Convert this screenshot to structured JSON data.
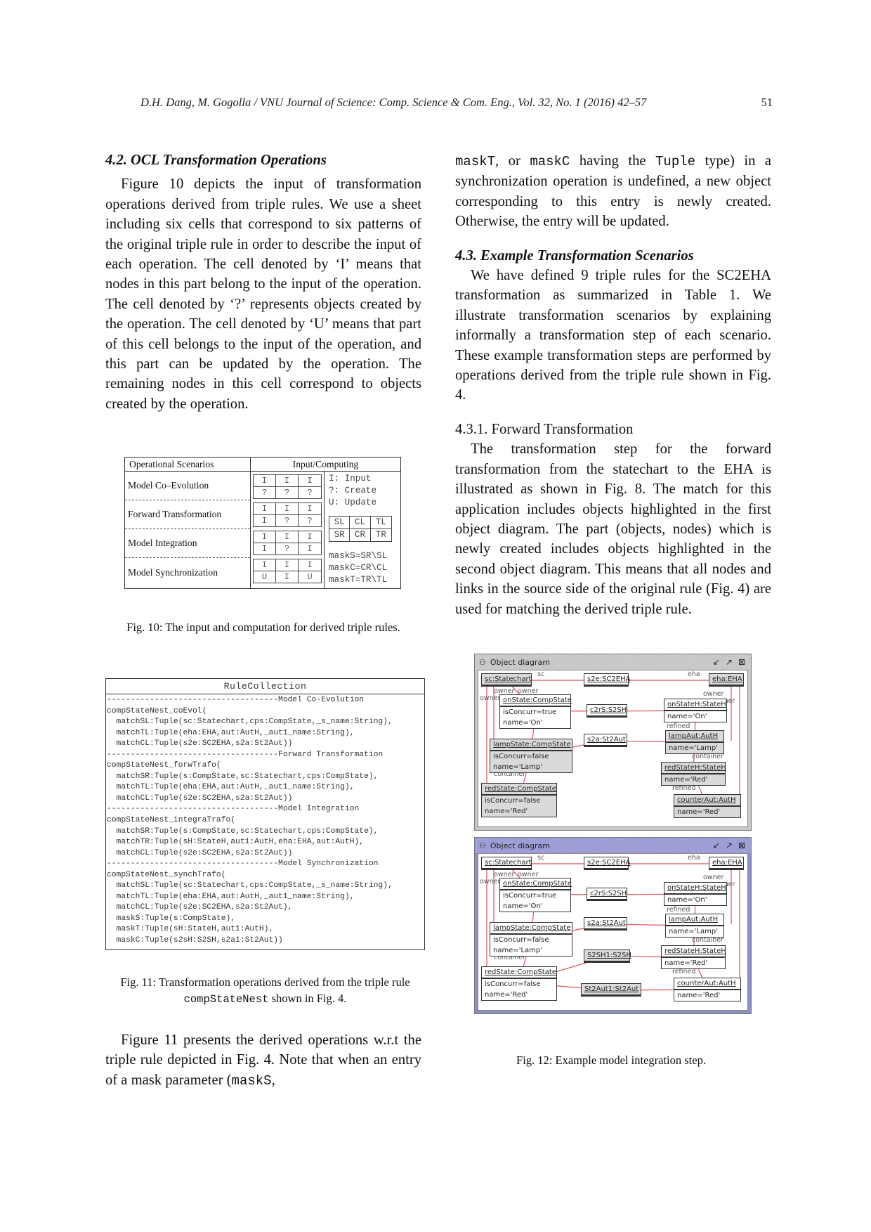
{
  "header": {
    "running_head": "D.H. Dang, M. Gogolla / VNU Journal of Science: Comp. Science & Com. Eng., Vol. 32, No. 1 (2016) 42–57",
    "page_number": "51"
  },
  "left_column": {
    "section_heading": "4.2.  OCL Transformation Operations",
    "paragraph_1": "Figure 10 depicts the input of transformation operations derived from triple rules.  We use a sheet including six cells that correspond to six patterns of the original triple rule in order to describe the input of each operation.  The cell denoted by ‘I’ means that nodes in this part belong to the input of the operation.  The cell denoted by ‘?’  represents objects created by the operation.  The cell denoted by ‘U’ means that part of this cell belongs to the input of the operation, and this part can be updated by the operation.  The remaining nodes in this cell correspond to objects created by the operation.",
    "paragraph_2_pre": "Figure 11 presents the derived operations w.r.t the triple rule depicted in Fig. 4.  Note that when an entry of a mask parameter (",
    "paragraph_2_code": "maskS",
    "paragraph_2_post": ","
  },
  "fig10": {
    "header_scenarios": "Operational Scenarios",
    "header_computing": "Input/Computing",
    "rows": [
      {
        "scenario": "Model Co–Evolution",
        "cells": [
          "I",
          "I",
          "I",
          "?",
          "?",
          "?"
        ]
      },
      {
        "scenario": "Forward Transformation",
        "cells": [
          "I",
          "I",
          "I",
          "I",
          "?",
          "?"
        ]
      },
      {
        "scenario": "Model Integration",
        "cells": [
          "I",
          "I",
          "I",
          "I",
          "?",
          "I"
        ]
      },
      {
        "scenario": "Model Synchronization",
        "cells": [
          "I",
          "I",
          "I",
          "U",
          "I",
          "U"
        ]
      }
    ],
    "legend": [
      "I: Input",
      "?: Create",
      "U: Update"
    ],
    "pattern_grid": [
      "SL",
      "CL",
      "TL",
      "SR",
      "CR",
      "TR"
    ],
    "masks": [
      "maskS=SR\\SL",
      "maskC=CR\\CL",
      "maskT=TR\\TL"
    ],
    "caption": "Fig. 10: The input and computation for derived triple rules."
  },
  "fig11": {
    "title": "RuleCollection",
    "lines": [
      "------------------------------------Model Co-Evolution",
      "compStateNest_coEvol(",
      "  matchSL:Tuple(sc:Statechart,cps:CompState,_s_name:String),",
      "  matchTL:Tuple(eha:EHA,aut:AutH,_aut1_name:String),",
      "  matchCL:Tuple(s2e:SC2EHA,s2a:St2Aut))",
      "------------------------------------Forward Transformation",
      "compStateNest_forwTrafo(",
      "  matchSR:Tuple(s:CompState,sc:Statechart,cps:CompState),",
      "  matchTL:Tuple(eha:EHA,aut:AutH,_aut1_name:String),",
      "  matchCL:Tuple(s2e:SC2EHA,s2a:St2Aut))",
      "------------------------------------Model Integration",
      "compStateNest_integraTrafo(",
      "  matchSR:Tuple(s:CompState,sc:Statechart,cps:CompState),",
      "  matchTR:Tuple(sH:StateH,aut1:AutH,eha:EHA,aut:AutH),",
      "  matchCL:Tuple(s2e:SC2EHA,s2a:St2Aut))",
      "------------------------------------Model Synchronization",
      "compStateNest_synchTrafo(",
      "  matchSL:Tuple(sc:Statechart,cps:CompState,_s_name:String),",
      "  matchTL:Tuple(eha:EHA,aut:AutH,_aut1_name:String),",
      "  matchCL:Tuple(s2e:SC2EHA,s2a:St2Aut),",
      "  maskS:Tuple(s:CompState),",
      "  maskT:Tuple(sH:StateH,aut1:AutH),",
      "  maskC:Tuple(s2sH:S2SH,s2a1:St2Aut))"
    ],
    "caption_pre": "Fig. 11: Transformation operations derived from the triple rule ",
    "caption_code": "compStateNest",
    "caption_post": " shown in Fig. 4."
  },
  "right_column": {
    "para_cont_code1": "maskT",
    "para_cont_mid1": ", or ",
    "para_cont_code2": "maskC",
    "para_cont_mid2": " having the ",
    "para_cont_code3": "Tuple",
    "para_cont_post": " type) in a synchronization operation is undefined, a new object corresponding to this entry is newly created. Otherwise, the entry will be updated.",
    "section_heading": "4.3.  Example Transformation Scenarios",
    "paragraph_1": "We have defined 9 triple rules for the SC2EHA transformation as summarized in Table 1.  We illustrate transformation scenarios by explaining informally a transformation step of each scenario.  These example transformation steps are performed by operations derived from the triple rule shown in Fig. 4.",
    "subsection_heading": "4.3.1.  Forward Transformation",
    "paragraph_2": "The transformation step for the forward transformation from the statechart to the EHA is illustrated as shown in Fig. 8.  The match for this application includes objects highlighted in the first object diagram.  The part (objects, nodes) which is newly created includes objects highlighted in the second object diagram.  This means that all nodes and links in the source side of the original rule (Fig. 4) are used for matching the derived triple rule."
  },
  "fig12": {
    "caption": "Fig. 12: Example model integration step.",
    "windows": [
      {
        "title": "Object diagram",
        "objects": {
          "sc": {
            "name": "sc:Statechart",
            "attrs": []
          },
          "s2e": {
            "name": "s2e:SC2EHA",
            "attrs": []
          },
          "eha": {
            "name": "eha:EHA",
            "attrs": []
          },
          "onState": {
            "name": "onState:CompState",
            "attrs": [
              "isConcurr=true",
              "name='On'"
            ]
          },
          "c2rS": {
            "name": "c2rS:S2SH",
            "attrs": []
          },
          "onStateH": {
            "name": "onStateH:StateH",
            "attrs": [
              "name='On'"
            ]
          },
          "lampState": {
            "name": "lampState:CompState",
            "attrs": [
              "isConcurr=false",
              "name='Lamp'"
            ]
          },
          "s2a": {
            "name": "s2a:St2Aut",
            "attrs": []
          },
          "lampAut": {
            "name": "lampAut:AutH",
            "attrs": [
              "name='Lamp'"
            ]
          },
          "redStateH": {
            "name": "redStateH:StateH",
            "attrs": [
              "name='Red'"
            ]
          },
          "redState": {
            "name": "redState:CompState",
            "attrs": [
              "isConcurr=false",
              "name='Red'"
            ]
          },
          "counterAut": {
            "name": "counterAut:AutH",
            "attrs": [
              "name='Red'"
            ]
          }
        },
        "role_labels": [
          "sc",
          "eha",
          "owner",
          "owner",
          "owner",
          "owner",
          "owner",
          "container",
          "refined",
          "container",
          "container",
          "refined"
        ]
      },
      {
        "title": "Object diagram",
        "objects": {
          "sc": {
            "name": "sc:Statechart",
            "attrs": []
          },
          "s2e": {
            "name": "s2e:SC2EHA",
            "attrs": []
          },
          "eha": {
            "name": "eha:EHA",
            "attrs": []
          },
          "onState": {
            "name": "onState:CompState",
            "attrs": [
              "isConcurr=true",
              "name='On'"
            ]
          },
          "c2rS": {
            "name": "c2rS:S2SH",
            "attrs": []
          },
          "onStateH": {
            "name": "onStateH:StateH",
            "attrs": [
              "name='On'"
            ]
          },
          "lampState": {
            "name": "lampState:CompState",
            "attrs": [
              "isConcurr=false",
              "name='Lamp'"
            ]
          },
          "s2a": {
            "name": "s2a:St2Aut",
            "attrs": []
          },
          "lampAut": {
            "name": "lampAut:AutH",
            "attrs": [
              "name='Lamp'"
            ]
          },
          "s2sh1": {
            "name": "S2SH1:S2SH",
            "attrs": []
          },
          "redStateH": {
            "name": "redStateH:StateH",
            "attrs": [
              "name='Red'"
            ]
          },
          "redState": {
            "name": "redState:CompState",
            "attrs": [
              "isConcurr=false",
              "name='Red'"
            ]
          },
          "st2aut1": {
            "name": "St2Aut1:St2Aut",
            "attrs": []
          },
          "counterAut": {
            "name": "counterAut:AutH",
            "attrs": [
              "name='Red'"
            ]
          }
        },
        "role_labels": [
          "sc",
          "eha",
          "owner",
          "owner",
          "owner",
          "owner",
          "owner",
          "container",
          "refined",
          "container",
          "container",
          "refined"
        ]
      }
    ],
    "link_color": "#e0505a"
  }
}
